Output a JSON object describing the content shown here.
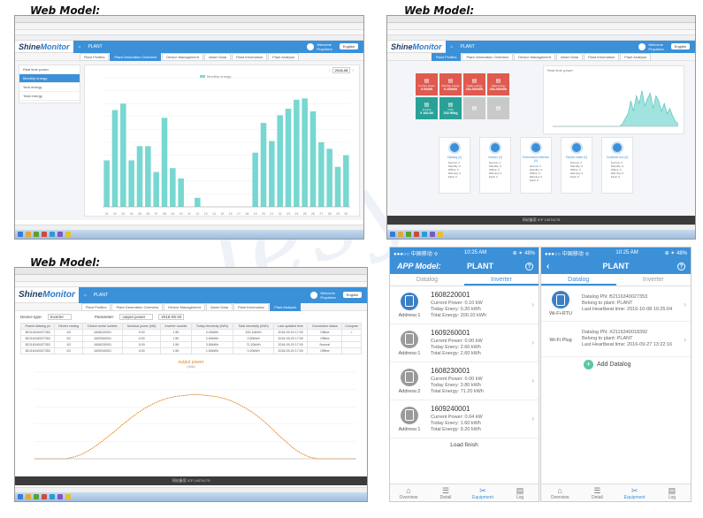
{
  "labels": {
    "web_model": "Web Model:",
    "app_model": "APP Model:"
  },
  "common": {
    "logo_a": "Shine",
    "logo_b": "Monitor",
    "plant": "PLANT",
    "user_a": "Welcome",
    "user_b": "Proprietor",
    "lang": "English",
    "footer": "网站备案 ICP 14074175",
    "tabs": [
      "Plant Profiles",
      "Plant Generation Overview",
      "Device Management",
      "Alarm Data",
      "Plant Information",
      "Plant Analysis"
    ]
  },
  "p1": {
    "active_tab": 1,
    "menu": [
      "Real time power",
      "Monthly energy",
      "Year energy",
      "Total energy"
    ],
    "active_menu": 1,
    "legend": "Monthly energy",
    "date": "2016-08"
  },
  "p2": {
    "active_tab": 0,
    "tiles": [
      {
        "label": "Current power",
        "value": "0.00kW",
        "color": "#e05a4f"
      },
      {
        "label": "Monthly energy",
        "value": "0.10kWh",
        "color": "#e05a4f"
      },
      {
        "label": "Yearly energy",
        "value": "201.00kWh",
        "color": "#e05a4f"
      },
      {
        "label": "Total energy",
        "value": "201.00kWh",
        "color": "#e05a4f"
      },
      {
        "label": "Income",
        "value": "¥ 160.80",
        "color": "#2aa198"
      },
      {
        "label": "CO2",
        "value": "202.90kg",
        "color": "#2aa198"
      },
      {
        "label": "",
        "value": "",
        "color": "#c9c9c9"
      },
      {
        "label": "",
        "value": "",
        "color": "#c9c9c9"
      }
    ],
    "chart_legend": "Real time power",
    "devices": [
      {
        "name": "Datalog (4)"
      },
      {
        "name": "Inverter (4)"
      },
      {
        "name": "Environment detector (0)"
      },
      {
        "name": "Electric meter (0)"
      },
      {
        "name": "Combiner box (0)"
      }
    ],
    "device_status": [
      "Normal: 4",
      "Standby: 0",
      "Offline: 0",
      "Warning: 0",
      "Fault: 0"
    ]
  },
  "p3": {
    "active_tab": 5,
    "device_type_label": "Device type:",
    "device_type": "Inverter",
    "param_label": "Parameter:",
    "param": "output power",
    "date": "2016-09-20",
    "columns": [
      "Parent datalog pn",
      "Device routing",
      "Device serial number",
      "Nominal power (kW)",
      "Inverter module",
      "Today electricity (kWh)",
      "Total electricity (kWh)",
      "Last updated time",
      "Connection status",
      "Compare"
    ],
    "rows": [
      [
        "B2116340027353",
        "1/2",
        "1608220001",
        "0.00",
        "1.5K",
        "0.00kWh",
        "200.10kWh",
        "2016-09-20 17:00",
        "Offline",
        "✓"
      ],
      [
        "B2116340027353",
        "2/2",
        "1609260001",
        "0.00",
        "1.5K",
        "2.60kWh",
        "2.60kWh",
        "2016-09-20 17:00",
        "Offline",
        ""
      ],
      [
        "B2116340027353",
        "1/2",
        "1608230001",
        "0.00",
        "1.5K",
        "3.80kWh",
        "71.20kWh",
        "2016-09-20 17:00",
        "Normal",
        ""
      ],
      [
        "B2116340027353",
        "2/2",
        "1609240001",
        "0.00",
        "1.5K",
        "1.60kWh",
        "9.20kWh",
        "2016-09-20 17:00",
        "Offline",
        ""
      ]
    ],
    "chart_title": "output power",
    "chart_sub": "(Watt)"
  },
  "phone_left": {
    "carrier": "●●●○○ 中国移动 ≎",
    "time": "10:25 AM",
    "battery": "⊕ ✶ 48%",
    "title": "PLANT",
    "tabs": [
      "Datalog",
      "Inverter"
    ],
    "active_tab": 1,
    "inverters": [
      {
        "sn": "1608220001",
        "power": "Current Power: 0.10 kW",
        "today": "Today Enery: 0.20 kWh",
        "total": "Total Energy: 200.10 kWh",
        "addr": "Address:1",
        "color": "#3c7fc4"
      },
      {
        "sn": "1609260001",
        "power": "Current Power: 0.00 kW",
        "today": "Today Enery: 2.60 kWh",
        "total": "Total Energy: 2.60 kWh",
        "addr": "Address:1",
        "color": "#9a9a9a"
      },
      {
        "sn": "1608230001",
        "power": "Current Power: 0.00 kW",
        "today": "Today Enery: 3.80 kWh",
        "total": "Total Energy: 71.20 kWh",
        "addr": "Address:2",
        "color": "#9a9a9a"
      },
      {
        "sn": "1609240001",
        "power": "Current Power: 0.04 kW",
        "today": "Today Enery: 1.60 kWh",
        "total": "Total Energy: 9.20 kWh",
        "addr": "Address:1",
        "color": "#9a9a9a"
      }
    ],
    "load_finish": "Load finish"
  },
  "phone_right": {
    "carrier": "●●●○○ 中国移动 ≎",
    "time": "10:25 AM",
    "battery": "⊕ ✶ 48%",
    "title": "PLANT",
    "tabs": [
      "Datalog",
      "Inverter"
    ],
    "active_tab": 0,
    "datalogs": [
      {
        "type": "Wi-Fi-RTU",
        "pn": "Datalog PN: B2116340027353",
        "plant": "Belong to plant: PLANT",
        "hb": "Last Heartbeat time: 2016-10-08 10:25:04"
      },
      {
        "type": "Wi-Fi Plug",
        "pn": "Datalog PN: X2116340018392",
        "plant": "Belong to plant: PLANT",
        "hb": "Last Heartbeat time: 2016-09-27 13:22:16"
      }
    ],
    "add": "Add Datalog"
  },
  "bottom_nav": [
    {
      "label": "Overview",
      "icon": "⌂"
    },
    {
      "label": "Detail",
      "icon": "☰"
    },
    {
      "label": "Equipment",
      "icon": "✂"
    },
    {
      "label": "Log",
      "icon": "▤"
    }
  ],
  "bottom_active": 2,
  "chart_data": [
    {
      "type": "bar",
      "title": "",
      "series": [
        {
          "name": "Monthly energy",
          "values": [
            0.36,
            0.75,
            0.8,
            0.36,
            0.47,
            0.47,
            0.27,
            0.69,
            0.3,
            0.22,
            0.0,
            0.07,
            0.0,
            0.0,
            0.0,
            0.0,
            0.0,
            0.0,
            0.42,
            0.65,
            0.51,
            0.71,
            0.76,
            0.83,
            0.84,
            0.74,
            0.5,
            0.45,
            0.31,
            0.4
          ]
        }
      ],
      "categories": [
        "01",
        "02",
        "03",
        "04",
        "05",
        "06",
        "07",
        "08",
        "09",
        "10",
        "11",
        "12",
        "13",
        "14",
        "15",
        "16",
        "17",
        "18",
        "19",
        "20",
        "21",
        "22",
        "23",
        "24",
        "25",
        "26",
        "27",
        "28",
        "29",
        "30"
      ],
      "ylim": [
        0,
        1.0
      ],
      "ylabel": ""
    },
    {
      "type": "area",
      "title": "",
      "series": [
        {
          "name": "Real time power",
          "values": [
            0,
            0,
            0,
            0,
            0,
            0,
            0,
            0,
            0,
            0,
            0,
            0,
            0,
            0,
            0,
            0,
            0,
            0,
            0,
            0,
            0,
            0,
            0,
            0,
            0,
            0.05,
            0.15,
            0.25,
            0.5,
            0.3,
            0.6,
            0.45,
            0.7,
            0.4,
            0.55,
            0.65,
            0.35,
            0.6,
            0.5,
            0.3,
            0.45,
            0.25,
            0.35,
            0.2,
            0.1,
            0.05
          ]
        }
      ],
      "ylim": [
        0,
        1.0
      ]
    },
    {
      "type": "line",
      "title": "output power",
      "series": [
        {
          "name": "1608220001",
          "values": [
            0,
            0,
            0,
            0,
            0,
            0.02,
            0.05,
            0.1,
            0.16,
            0.23,
            0.3,
            0.38,
            0.45,
            0.52,
            0.58,
            0.63,
            0.67,
            0.7,
            0.72,
            0.73,
            0.74,
            0.74,
            0.73,
            0.72,
            0.7,
            0.67,
            0.63,
            0.58,
            0.52,
            0.45,
            0.37,
            0.28,
            0.2,
            0.12,
            0.06,
            0.02,
            0,
            0,
            0,
            0,
            0,
            0
          ]
        }
      ],
      "ylim": [
        0,
        1.0
      ]
    }
  ]
}
